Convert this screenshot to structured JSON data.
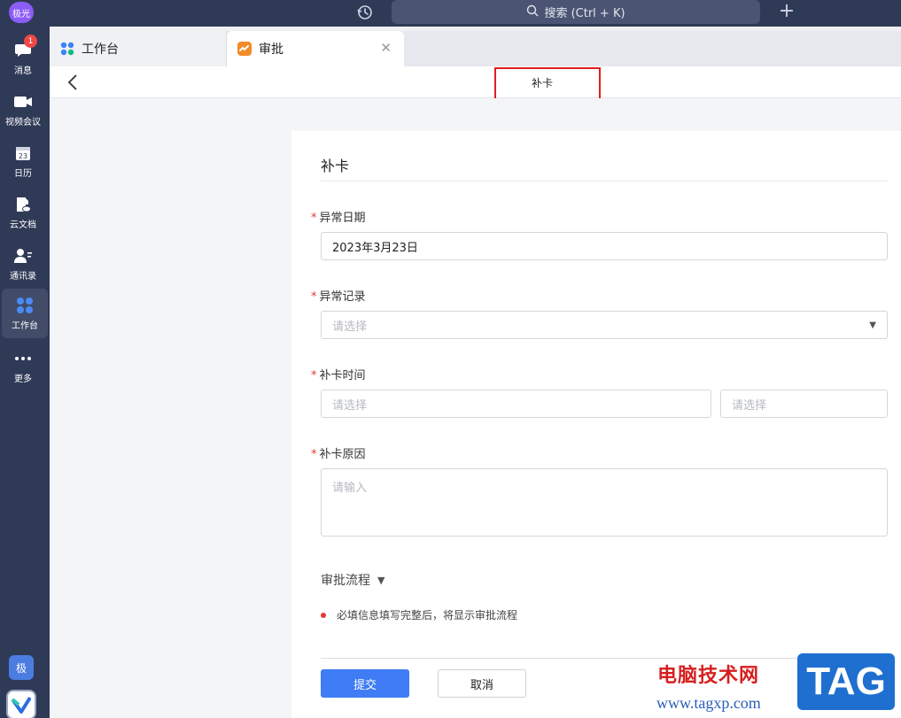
{
  "topbar": {
    "avatar_text": "极光",
    "search_placeholder": "搜索 (Ctrl + K)",
    "history_icon": "clock-history-icon",
    "add_icon": "plus-icon"
  },
  "sidebar": {
    "items": [
      {
        "label": "消息",
        "icon": "chat-bubble-icon",
        "badge": "1"
      },
      {
        "label": "视频会议",
        "icon": "video-camera-icon"
      },
      {
        "label": "日历",
        "icon": "calendar-icon",
        "icon_text": "23"
      },
      {
        "label": "云文档",
        "icon": "cloud-doc-icon"
      },
      {
        "label": "通讯录",
        "icon": "contacts-icon"
      },
      {
        "label": "工作台",
        "icon": "workbench-grid-icon",
        "active": true
      },
      {
        "label": "更多",
        "icon": "more-dots-icon"
      }
    ],
    "bottom_avatar_text": "极"
  },
  "tabs": [
    {
      "label": "工作台",
      "icon": "workbench-grid-icon"
    },
    {
      "label": "审批",
      "icon": "approval-icon",
      "active": true,
      "close_icon": "close-icon"
    }
  ],
  "header": {
    "title": "补卡"
  },
  "form": {
    "title": "补卡",
    "fields": {
      "abnormal_date": {
        "label": "异常日期",
        "value": "2023年3月23日"
      },
      "abnormal_record": {
        "label": "异常记录",
        "placeholder": "请选择"
      },
      "makeup_time": {
        "label": "补卡时间",
        "placeholder_date": "请选择",
        "placeholder_time": "请选择"
      },
      "makeup_reason": {
        "label": "补卡原因",
        "placeholder": "请输入"
      }
    },
    "required_mark": "*",
    "flow": {
      "label": "审批流程",
      "hint": "必填信息填写完整后，将显示审批流程"
    },
    "buttons": {
      "submit": "提交",
      "cancel": "取消"
    }
  },
  "watermark": {
    "site_name": "电脑技术网",
    "url": "www.tagxp.com",
    "tag": "TAG"
  },
  "colors": {
    "sidebar_bg": "#2f3a57",
    "primary": "#3f7cf5",
    "required": "#e53935",
    "highlight": "#e11d1d"
  }
}
